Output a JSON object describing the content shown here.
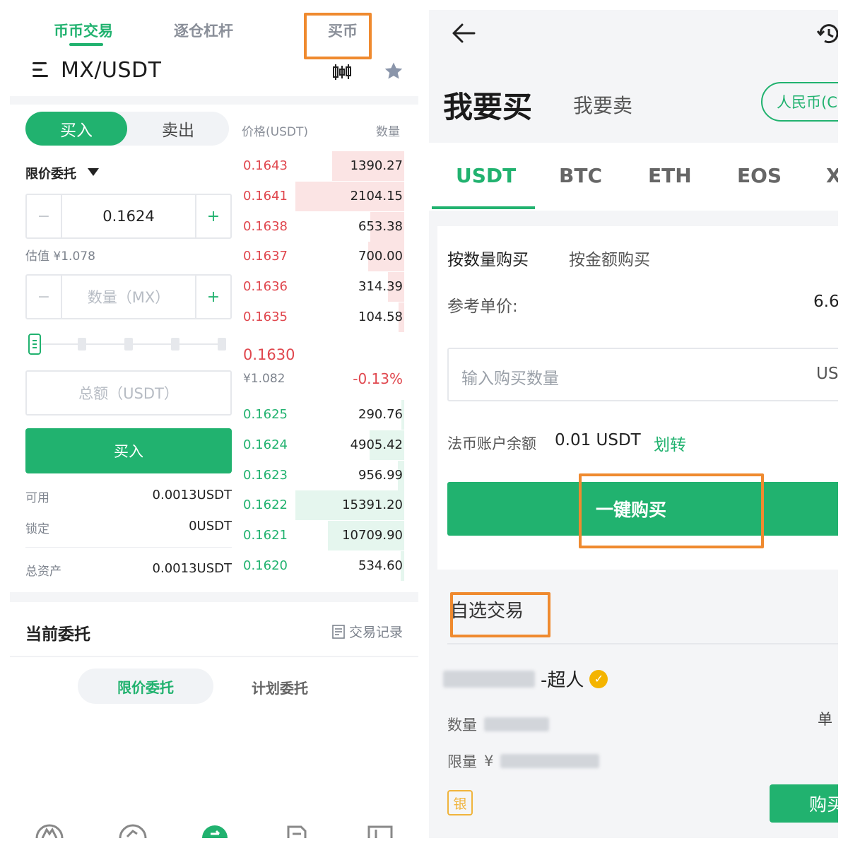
{
  "left": {
    "top_tabs": [
      "币币交易",
      "逐仓杠杆",
      "买币"
    ],
    "pair": "MX/USDT",
    "side_tabs": {
      "buy": "买入",
      "sell": "卖出"
    },
    "order_type": "限价委托",
    "price_input": {
      "value": "0.1624",
      "minus": "−",
      "plus": "+"
    },
    "estimate": "估值 ¥1.078",
    "quantity_input": {
      "placeholder": "数量（MX）",
      "minus": "−",
      "plus": "+"
    },
    "total_placeholder": "总额（USDT）",
    "buy_button": "买入",
    "available": {
      "label": "可用",
      "value": "0.0013USDT"
    },
    "locked": {
      "label": "锁定",
      "value": "0USDT"
    },
    "total_assets": {
      "label": "总资产",
      "value": "0.0013USDT"
    },
    "orderbook": {
      "price_header": "价格(USDT)",
      "qty_header": "数量",
      "asks": [
        {
          "price": "0.1643",
          "qty": "1390.27",
          "depth": 0.66
        },
        {
          "price": "0.1641",
          "qty": "2104.15",
          "depth": 1.0
        },
        {
          "price": "0.1638",
          "qty": "653.38",
          "depth": 0.31
        },
        {
          "price": "0.1637",
          "qty": "700.00",
          "depth": 0.33
        },
        {
          "price": "0.1636",
          "qty": "314.39",
          "depth": 0.15
        },
        {
          "price": "0.1635",
          "qty": "104.58",
          "depth": 0.05
        }
      ],
      "last_price": "0.1630",
      "last_cny": "¥1.082",
      "change": "-0.13%",
      "bids": [
        {
          "price": "0.1625",
          "qty": "290.76",
          "depth": 0.02
        },
        {
          "price": "0.1624",
          "qty": "4905.42",
          "depth": 0.32
        },
        {
          "price": "0.1623",
          "qty": "956.99",
          "depth": 0.06
        },
        {
          "price": "0.1622",
          "qty": "15391.20",
          "depth": 1.0
        },
        {
          "price": "0.1621",
          "qty": "10709.90",
          "depth": 0.7
        },
        {
          "price": "0.1620",
          "qty": "534.60",
          "depth": 0.03
        }
      ]
    },
    "current_orders_title": "当前委托",
    "trade_record": "交易记录",
    "order_tabs": {
      "limit": "限价委托",
      "plan": "计划委托"
    }
  },
  "right": {
    "buy_heading": "我要买",
    "sell_heading": "我要卖",
    "currency_pill": "人民币(C",
    "coin_tabs": [
      "USDT",
      "BTC",
      "ETH",
      "EOS",
      "X"
    ],
    "purchase_modes": {
      "by_quantity": "按数量购买",
      "by_amount": "按金额购买"
    },
    "reference_price_label": "参考单价:",
    "reference_price_value": "6.6",
    "quantity_placeholder": "输入购买数量",
    "quantity_unit": "US",
    "balance_label": "法币账户余额",
    "balance_value": "0.01 USDT",
    "transfer_link": "划转",
    "one_click_buy": "一键购买",
    "favorites_title": "自选交易",
    "merchant": {
      "name_suffix": "-超人",
      "quantity_label": "数量",
      "limit_label": "限量",
      "limit_prefix": "¥",
      "unit_price_label": "单",
      "badge": "银",
      "buy_button": "购买"
    }
  },
  "colors": {
    "accent_green": "#21b26f",
    "ask_red": "#e0474e",
    "highlight_orange": "#ef8a2f"
  }
}
